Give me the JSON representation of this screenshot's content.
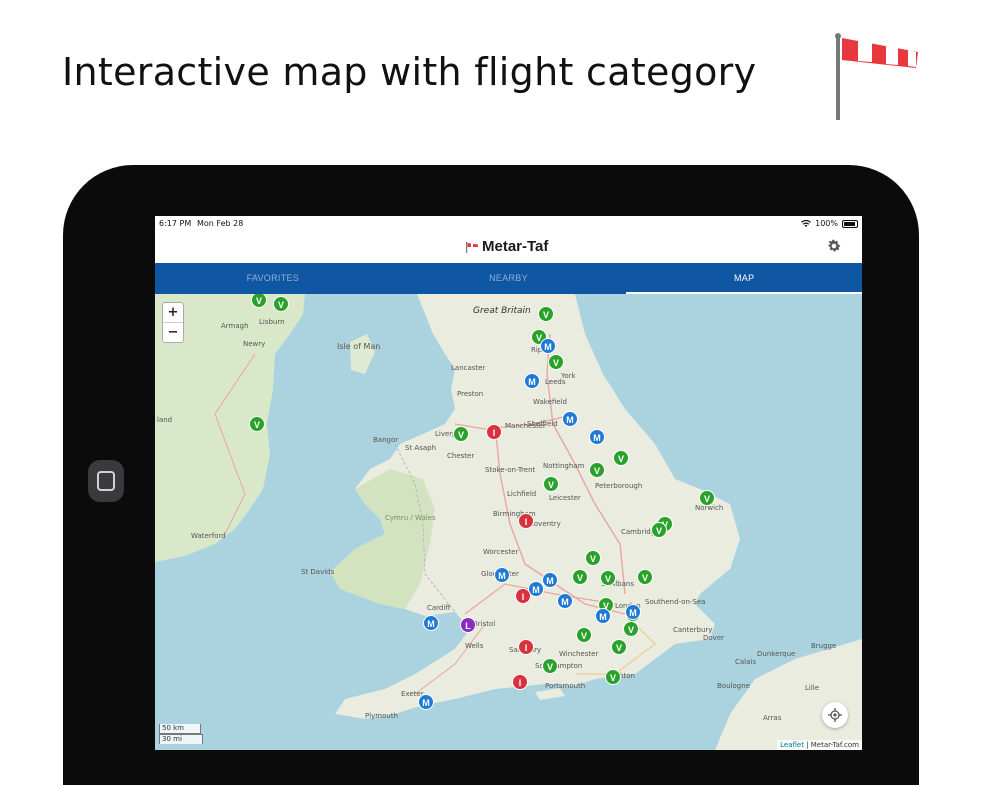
{
  "headline": "Interactive map with flight category",
  "status": {
    "time": "6:17 PM",
    "date": "Mon Feb 28",
    "battery": "100%"
  },
  "app": {
    "title": "Metar-Taf"
  },
  "tabs": [
    {
      "label": "FAVORITES",
      "active": false
    },
    {
      "label": "NEARBY",
      "active": false
    },
    {
      "label": "MAP",
      "active": true
    }
  ],
  "map": {
    "zoom_in": "+",
    "zoom_out": "−",
    "scale_km": "50 km",
    "scale_mi": "30 mi",
    "attribution_link": "Leaflet",
    "attribution_sep": " | ",
    "attribution_text": "Metar-Taf.com",
    "labels": [
      "Great Britain",
      "Isle of Man",
      "Lisburn",
      "Armagh",
      "Newry",
      "land",
      "Lancaster",
      "Ripon",
      "York",
      "Leeds",
      "Preston",
      "Wakefield",
      "Sheffield",
      "Manchester",
      "Liverpool",
      "Bangor",
      "St Asaph",
      "Chester",
      "Stoke-on-Trent",
      "Nottingham",
      "Lichfield",
      "Leicester",
      "Peterborough",
      "Norwich",
      "Birmingham",
      "Coventry",
      "Cambridge",
      "Waterford",
      "Cymru / Wales",
      "St Davids",
      "Worcester",
      "Gloucester",
      "St Albans",
      "Southend-on-Sea",
      "London",
      "Cardiff",
      "Bristol",
      "Wells",
      "Salisbury",
      "Winchester",
      "Southampton",
      "Portsmouth",
      "Brighton",
      "Exeter",
      "Plymouth",
      "Dunkerque",
      "Brugge",
      "Lille",
      "Calais",
      "Boulogne",
      "Arras",
      "Dover",
      "Canterbury"
    ],
    "colors": {
      "vfr": "#2aa12a",
      "mvfr": "#1f7ad6",
      "ifr": "#d9313d",
      "lifr": "#8a2bc2",
      "sea": "#aad3df",
      "land": "#f2efe9"
    }
  },
  "markers": {
    "vfr_letter": "V",
    "mvfr_letter": "M",
    "ifr_letter": "I",
    "lifr_letter": "L"
  },
  "icons": [
    "windsock-logo",
    "wifi-icon",
    "battery-icon",
    "gear-icon",
    "locate-icon",
    "home-button-icon"
  ]
}
